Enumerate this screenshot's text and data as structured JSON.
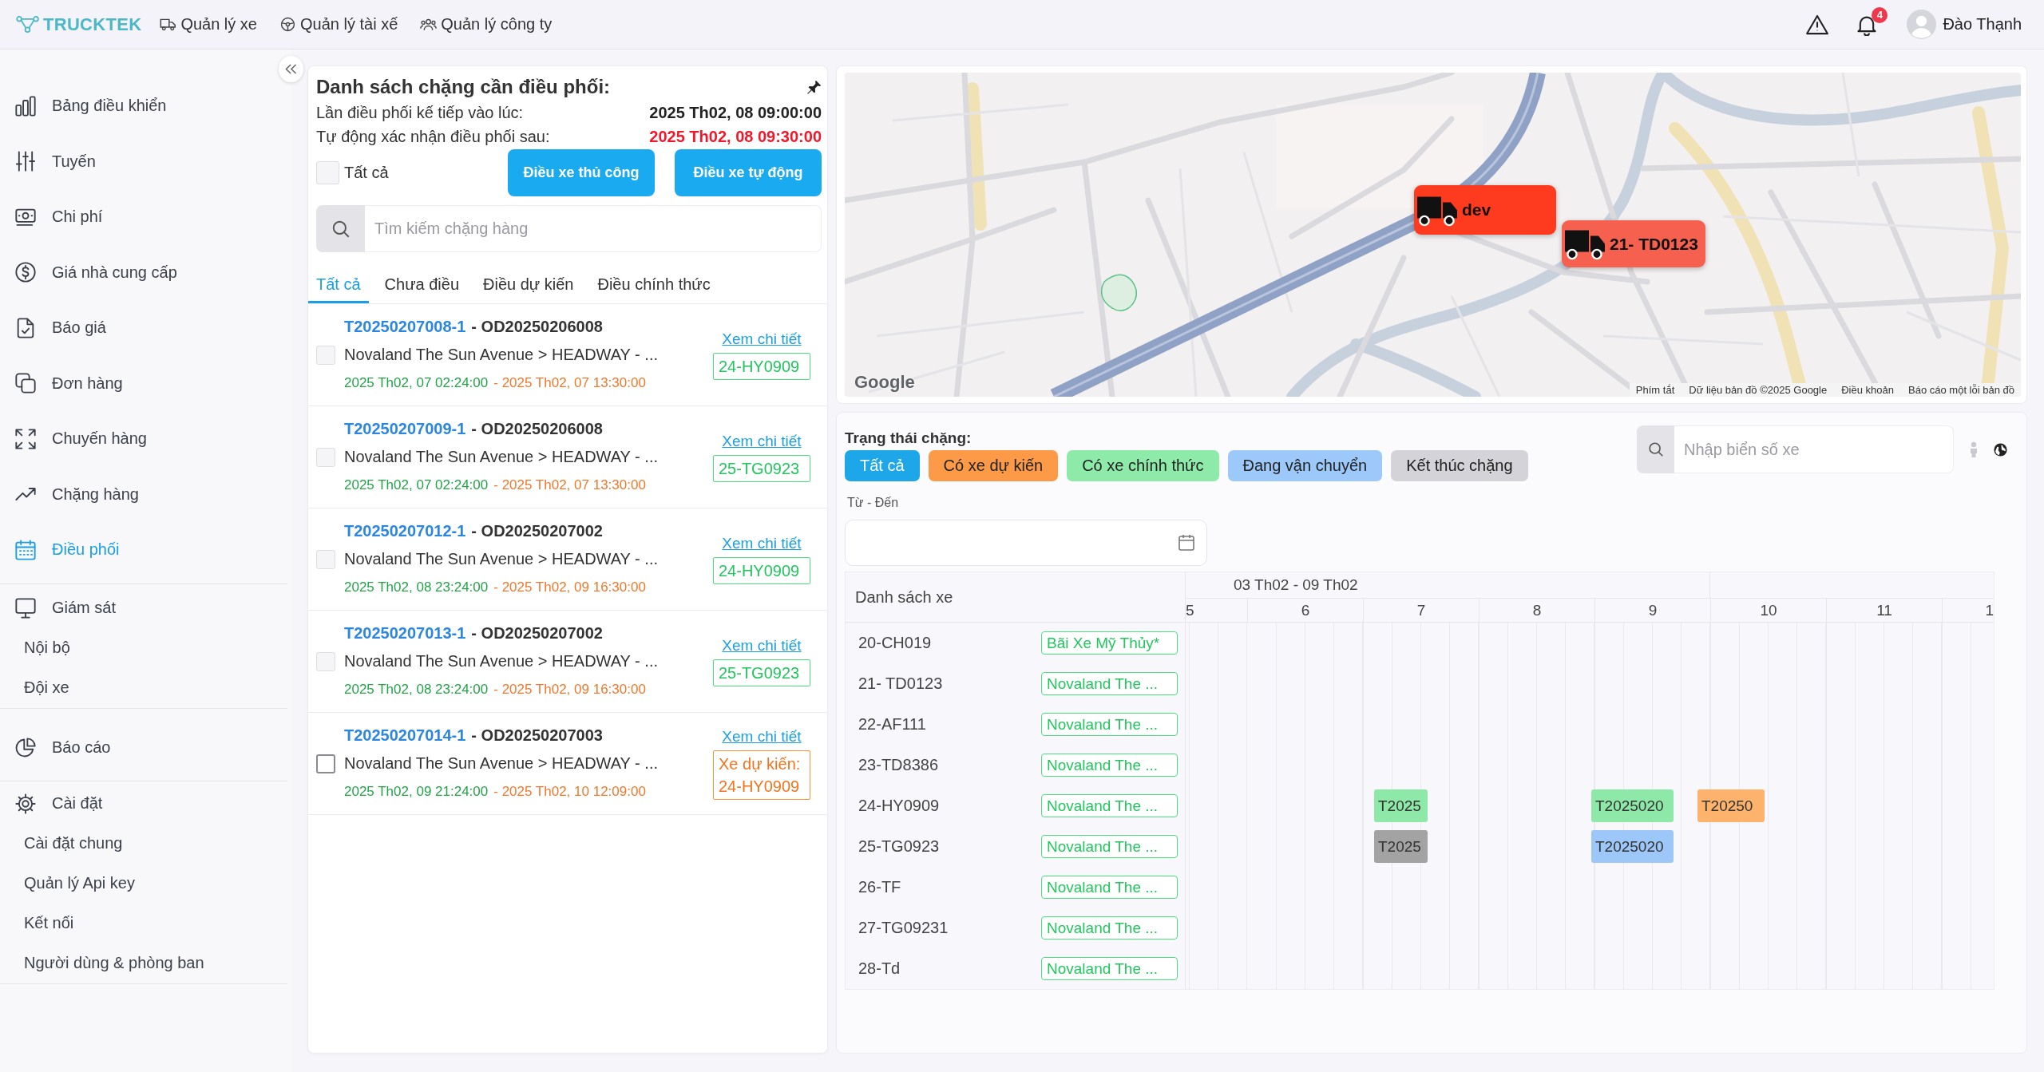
{
  "header": {
    "logo": "TRUCKTEK",
    "nav": [
      "Quản lý xe",
      "Quản lý tài xế",
      "Quản lý công ty"
    ],
    "notification_count": "4",
    "user_name": "Đào Thạnh"
  },
  "sidebar": {
    "sections": [
      {
        "items": [
          {
            "label": "Bảng điều khiển",
            "selected": false
          },
          {
            "label": "Tuyến",
            "selected": false
          },
          {
            "label": "Chi phí",
            "selected": false
          },
          {
            "label": "Giá nhà cung cấp",
            "selected": false
          },
          {
            "label": "Báo giá",
            "selected": false
          },
          {
            "label": "Đơn hàng",
            "selected": false
          },
          {
            "label": "Chuyến hàng",
            "selected": false
          },
          {
            "label": "Chặng hàng",
            "selected": false
          },
          {
            "label": "Điều phối",
            "selected": true
          }
        ]
      },
      {
        "items": [
          {
            "label": "Giám sát",
            "selected": false,
            "children": [
              {
                "label": "Nội bộ",
                "selected": false
              },
              {
                "label": "Đội xe",
                "selected": false
              }
            ]
          }
        ]
      },
      {
        "items": [
          {
            "label": "Báo cáo",
            "selected": false
          }
        ]
      },
      {
        "items": [
          {
            "label": "Cài đặt",
            "selected": false,
            "children": [
              {
                "label": "Cài đặt chung",
                "selected": false
              },
              {
                "label": "Quản lý Api key",
                "selected": false
              },
              {
                "label": "Kết nối",
                "selected": false
              },
              {
                "label": "Người dùng & phòng ban",
                "selected": false
              }
            ]
          }
        ]
      }
    ]
  },
  "dispatch_list": {
    "title": "Danh sách chặng cần điều phối:",
    "next_run": {
      "label": "Lần điều phối kế tiếp vào lúc:",
      "value": "2025 Th02, 08 09:00:00"
    },
    "auto_confirm": {
      "label": "Tự động xác nhận điều phối sau:",
      "value": "2025 Th02, 08 09:30:00"
    },
    "select_all": {
      "label": "Tất cả",
      "checked": false,
      "disabled": true
    },
    "buttons": [
      "Điều xe thủ công",
      "Điều xe tự động"
    ],
    "search": {
      "placeholder": "Tìm kiếm chặng hàng"
    },
    "tabs": [
      {
        "label": "Tất cả",
        "selected": true
      },
      {
        "label": "Chưa điều",
        "selected": false
      },
      {
        "label": "Điều dự kiến",
        "selected": false
      },
      {
        "label": "Điều chính thức",
        "selected": false
      }
    ],
    "items": [
      {
        "code": "T20250207008-1",
        "order": "- OD20250206008",
        "route": "Novaland The Sun Avenue > HEADWAY - ...",
        "start": "2025 Th02, 07 02:24:00",
        "end": "- 2025 Th02, 07 13:30:00",
        "link": "Xem chi tiết",
        "vehicle": {
          "text": "24-HY0909",
          "kind": "official"
        },
        "checked": false,
        "disabled": true
      },
      {
        "code": "T20250207009-1",
        "order": "- OD20250206008",
        "route": "Novaland The Sun Avenue > HEADWAY - ...",
        "start": "2025 Th02, 07 02:24:00",
        "end": "- 2025 Th02, 07 13:30:00",
        "link": "Xem chi tiết",
        "vehicle": {
          "text": "25-TG0923",
          "kind": "official"
        },
        "checked": false,
        "disabled": true
      },
      {
        "code": "T20250207012-1",
        "order": "- OD20250207002",
        "route": "Novaland The Sun Avenue > HEADWAY - ...",
        "start": "2025 Th02, 08 23:24:00",
        "end": "- 2025 Th02, 09 16:30:00",
        "link": "Xem chi tiết",
        "vehicle": {
          "text": "24-HY0909",
          "kind": "official"
        },
        "checked": false,
        "disabled": true
      },
      {
        "code": "T20250207013-1",
        "order": "- OD20250207002",
        "route": "Novaland The Sun Avenue > HEADWAY - ...",
        "start": "2025 Th02, 08 23:24:00",
        "end": "- 2025 Th02, 09 16:30:00",
        "link": "Xem chi tiết",
        "vehicle": {
          "text": "25-TG0923",
          "kind": "official"
        },
        "checked": false,
        "disabled": true
      },
      {
        "code": "T20250207014-1",
        "order": "- OD20250207003",
        "route": "Novaland The Sun Avenue > HEADWAY - ...",
        "start": "2025 Th02, 09 21:24:00",
        "end": "- 2025 Th02, 10 12:09:00",
        "link": "Xem chi tiết",
        "vehicle": {
          "text": "Xe dự kiến: 24-HY0909",
          "kind": "expected"
        },
        "checked": false,
        "disabled": false
      }
    ]
  },
  "map": {
    "markers": [
      {
        "label": "dev",
        "color": "#ff3b1f"
      },
      {
        "label": "21- TD0123",
        "color": "#f5604f"
      }
    ],
    "logo": "Google",
    "attribution": [
      "Phím tắt",
      "Dữ liệu bản đồ ©2025 Google",
      "Điều khoản",
      "Báo cáo một lỗi bản đồ"
    ]
  },
  "schedule": {
    "status_label": "Trạng thái chặng:",
    "statuses": [
      {
        "label": "Tất cả",
        "selected": true,
        "color": "#1ea7e8"
      },
      {
        "label": "Có xe dự kiến",
        "selected": false,
        "color": "#fd9a48"
      },
      {
        "label": "Có xe chính thức",
        "selected": false,
        "color": "#8eeaa8"
      },
      {
        "label": "Đang vận chuyển",
        "selected": false,
        "color": "#9cc8fa"
      },
      {
        "label": "Kết thúc chặng",
        "selected": false,
        "color": "#d4d4d8"
      }
    ],
    "plate_search": {
      "placeholder": "Nhập biển số xe"
    },
    "date_range": {
      "label": "Từ - Đến"
    },
    "gantt": {
      "column_title": "Danh sách xe",
      "week": "03 Th02 - 09 Th02",
      "days": [
        "5",
        "6",
        "7",
        "8",
        "9",
        "10",
        "11",
        "1"
      ],
      "vehicles": [
        {
          "plate": "20-CH019",
          "location": "Bãi Xe Mỹ Thủy*"
        },
        {
          "plate": "21- TD0123",
          "location": "Novaland The ..."
        },
        {
          "plate": "22-AF111",
          "location": "Novaland The ..."
        },
        {
          "plate": "23-TD8386",
          "location": "Novaland The ..."
        },
        {
          "plate": "24-HY0909",
          "location": "Novaland The ...",
          "trips": [
            {
              "label": "T2025",
              "color": "#8ee8a8"
            },
            {
              "label": "T2025020",
              "color": "#8ee8a8"
            },
            {
              "label": "T20250",
              "color": "#fdb36c"
            }
          ]
        },
        {
          "plate": "25-TG0923",
          "location": "Novaland The ...",
          "trips": [
            {
              "label": "T2025",
              "color": "#a3a3a3"
            },
            {
              "label": "T2025020",
              "color": "#9cc7f8"
            }
          ]
        },
        {
          "plate": "26-TF",
          "location": "Novaland The ..."
        },
        {
          "plate": "27-TG09231",
          "location": "Novaland The ..."
        },
        {
          "plate": "28-Td",
          "location": "Novaland The ..."
        }
      ]
    }
  }
}
